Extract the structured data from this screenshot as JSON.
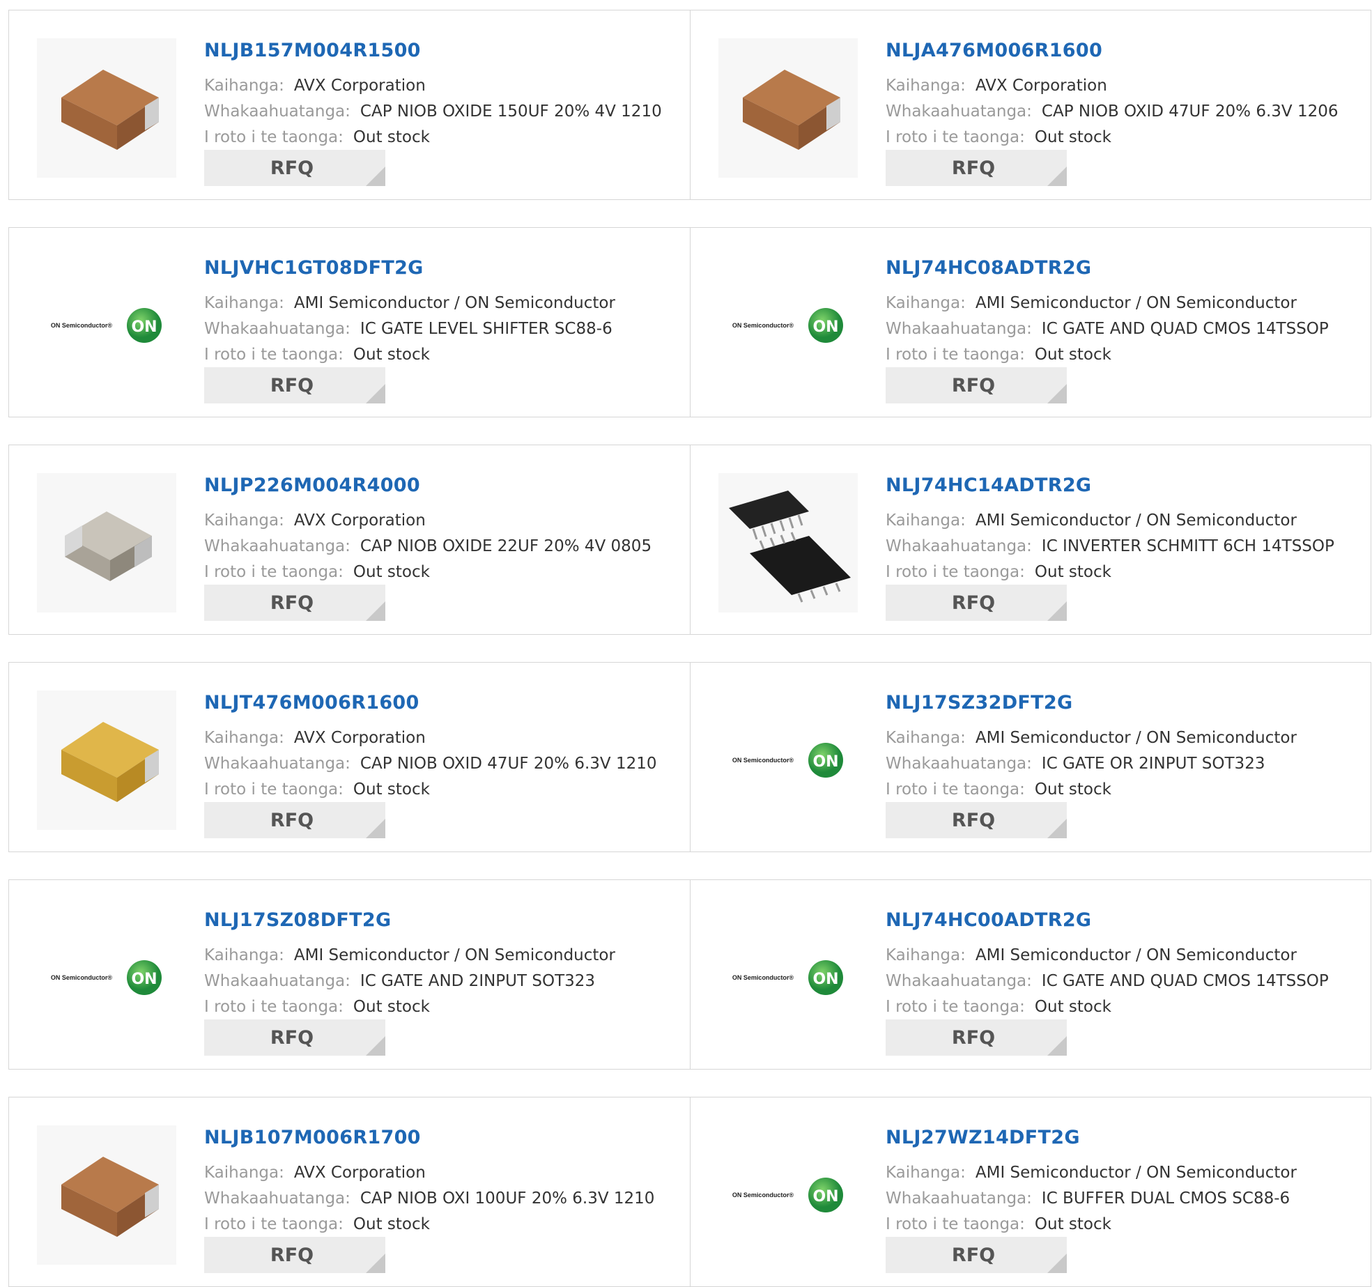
{
  "labels": {
    "manufacturer": "Kaihanga:",
    "description": "Whakaahuatanga:",
    "stock": "I roto i te taonga:",
    "rfq": "RFQ"
  },
  "on_logo_text": "ON Semiconductor",
  "on_logo_mark": "ON",
  "products": [
    {
      "pn": "NLJB157M004R1500",
      "mfr": "AVX Corporation",
      "desc": "CAP NIOB OXIDE 150UF 20% 4V 1210",
      "stock": "Out stock",
      "image": "brown-tantalum-cap"
    },
    {
      "pn": "NLJA476M006R1600",
      "mfr": "AVX Corporation",
      "desc": "CAP NIOB OXID 47UF 20% 6.3V 1206",
      "stock": "Out stock",
      "image": "brown-tantalum-cap"
    },
    {
      "pn": "NLJVHC1GT08DFT2G",
      "mfr": "AMI Semiconductor / ON Semiconductor",
      "desc": "IC GATE LEVEL SHIFTER SC88-6",
      "stock": "Out stock",
      "image": "on-semiconductor-logo"
    },
    {
      "pn": "NLJ74HC08ADTR2G",
      "mfr": "AMI Semiconductor / ON Semiconductor",
      "desc": "IC GATE AND QUAD CMOS 14TSSOP",
      "stock": "Out stock",
      "image": "on-semiconductor-logo"
    },
    {
      "pn": "NLJP226M004R4000",
      "mfr": "AVX Corporation",
      "desc": "CAP NIOB OXIDE 22UF 20% 4V 0805",
      "stock": "Out stock",
      "image": "silver-ceramic-cap"
    },
    {
      "pn": "NLJ74HC14ADTR2G",
      "mfr": "AMI Semiconductor / ON Semiconductor",
      "desc": "IC INVERTER SCHMITT 6CH 14TSSOP",
      "stock": "Out stock",
      "image": "tssop-chip"
    },
    {
      "pn": "NLJT476M006R1600",
      "mfr": "AVX Corporation",
      "desc": "CAP NIOB OXID 47UF 20% 6.3V 1210",
      "stock": "Out stock",
      "image": "yellow-tantalum-cap"
    },
    {
      "pn": "NLJ17SZ32DFT2G",
      "mfr": "AMI Semiconductor / ON Semiconductor",
      "desc": "IC GATE OR 2INPUT SOT323",
      "stock": "Out stock",
      "image": "on-semiconductor-logo"
    },
    {
      "pn": "NLJ17SZ08DFT2G",
      "mfr": "AMI Semiconductor / ON Semiconductor",
      "desc": "IC GATE AND 2INPUT SOT323",
      "stock": "Out stock",
      "image": "on-semiconductor-logo"
    },
    {
      "pn": "NLJ74HC00ADTR2G",
      "mfr": "AMI Semiconductor / ON Semiconductor",
      "desc": "IC GATE AND QUAD CMOS 14TSSOP",
      "stock": "Out stock",
      "image": "on-semiconductor-logo"
    },
    {
      "pn": "NLJB107M006R1700",
      "mfr": "AVX Corporation",
      "desc": "CAP NIOB OXI 100UF 20% 6.3V 1210",
      "stock": "Out stock",
      "image": "brown-tantalum-cap"
    },
    {
      "pn": "NLJ27WZ14DFT2G",
      "mfr": "AMI Semiconductor / ON Semiconductor",
      "desc": "IC BUFFER DUAL CMOS SC88-6",
      "stock": "Out stock",
      "image": "on-semiconductor-logo"
    }
  ],
  "colors": {
    "part_number": "#1e67b4",
    "label": "#9a9a9a",
    "value": "#333333",
    "rfq_bg": "#ececec",
    "border": "#d6d6d6"
  }
}
